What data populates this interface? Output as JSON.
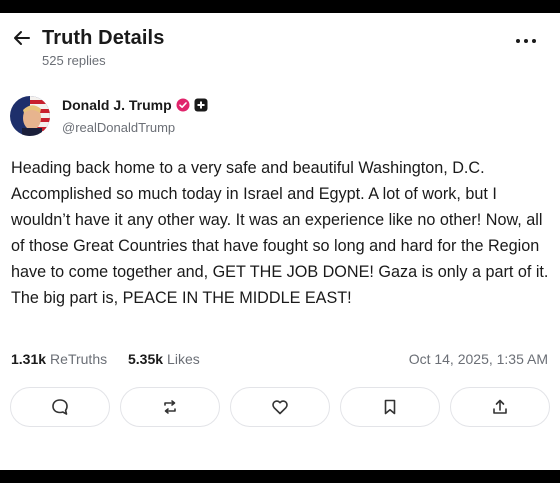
{
  "header": {
    "title": "Truth Details",
    "replies": "525 replies"
  },
  "author": {
    "display_name": "Donald J. Trump",
    "handle": "@realDonaldTrump"
  },
  "post": {
    "text": "Heading back home to a very safe and beautiful Washington, D.C. Accomplished so much today in Israel and Egypt. A lot of work, but I wouldn’t have it any other way. It was an experience like no other! Now, all of those Great Countries that have fought so long and hard for the Region have to come together and, GET THE JOB DONE! Gaza is only a part of it. The big part is, PEACE IN THE MIDDLE EAST!"
  },
  "stats": {
    "retruths_count": "1.31k",
    "retruths_label": "ReTruths",
    "likes_count": "5.35k",
    "likes_label": "Likes",
    "timestamp": "Oct 14, 2025, 1:35 AM"
  },
  "actions": [
    {
      "icon": "reply-icon"
    },
    {
      "icon": "retruth-icon"
    },
    {
      "icon": "like-icon"
    },
    {
      "icon": "bookmark-icon"
    },
    {
      "icon": "share-icon"
    }
  ],
  "colors": {
    "accent": "#5448ee",
    "verified_badge": "#e0246b",
    "muted_text": "#6b6f76",
    "border": "#e3e4e8"
  }
}
